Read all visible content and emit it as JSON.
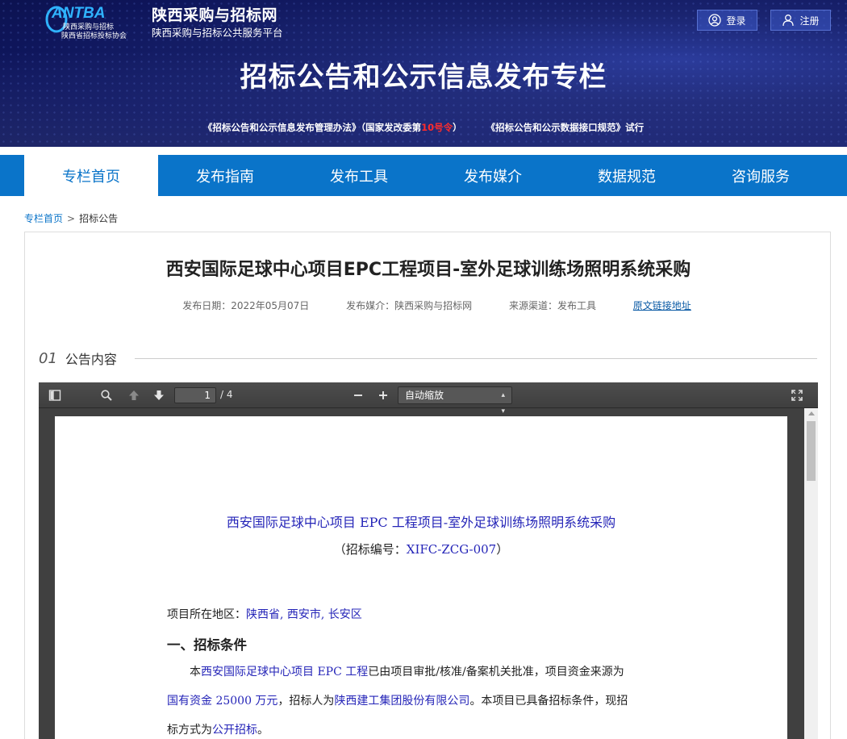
{
  "header": {
    "logo_text": "ANTBA",
    "logo_sub1": "陕西采购与招标",
    "logo_sub2": "陕西省招标投标协会",
    "site_name": "陕西采购与招标网",
    "site_sub": "陕西采购与招标公共服务平台",
    "login": "登录",
    "register": "注册",
    "banner_title": "招标公告和公示信息发布专栏",
    "link1_pre": "《招标公告和公示信息发布管理办法》（国家发改委第",
    "link1_red": "10号令",
    "link1_post": "）",
    "link2": "《招标公告和公示数据接口规范》试行"
  },
  "nav": {
    "items": [
      "专栏首页",
      "发布指南",
      "发布工具",
      "发布媒介",
      "数据规范",
      "咨询服务"
    ]
  },
  "breadcrumb": {
    "home": "专栏首页",
    "sep": ">",
    "current": "招标公告"
  },
  "article": {
    "title": "西安国际足球中心项目EPC工程项目-室外足球训练场照明系统采购",
    "date": "发布日期：2022年05月07日",
    "media": "发布媒介：陕西采购与招标网",
    "channel": "来源渠道：发布工具",
    "source_link": "原文链接地址",
    "section_num": "01",
    "section_label": "公告内容"
  },
  "viewer": {
    "page_current": "1",
    "page_total": "/ 4",
    "zoom": "自动缩放"
  },
  "document": {
    "title": "西安国际足球中心项目 EPC 工程项目-室外足球训练场照明系统采购",
    "code_pre": "（招标编号：",
    "code": "XIFC-ZCG-007",
    "code_post": "）",
    "location_label": "项目所在地区：",
    "location_value": "陕西省, 西安市, 长安区",
    "heading1": "一、招标条件",
    "p1_a": "本",
    "p1_b": "西安国际足球中心项目 EPC 工程",
    "p1_c": "已由项目审批/核准/备案机关批准，项目资金来源为",
    "p2_a": "国有资金 25000 万元",
    "p2_b": "，招标人为",
    "p2_c": "陕西建工集团股份有限公司",
    "p2_d": "。本项目已具备招标条件，现招",
    "p3_a": "标方式为",
    "p3_b": "公开招标",
    "p3_c": "。"
  }
}
